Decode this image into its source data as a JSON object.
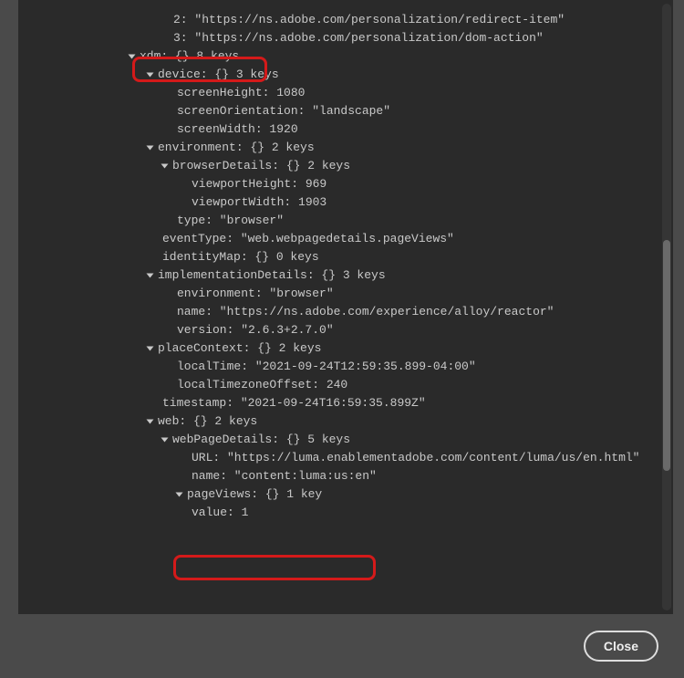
{
  "rows": {
    "index2": "2: \"https://ns.adobe.com/personalization/redirect-item\"",
    "index3": "3: \"https://ns.adobe.com/personalization/dom-action\"",
    "xdm": "xdm:  {}  8 keys",
    "device": "device:  {}  3 keys",
    "screenHeight": "screenHeight: 1080",
    "screenOrientation": "screenOrientation: \"landscape\"",
    "screenWidth": "screenWidth: 1920",
    "environment": "environment:  {}  2 keys",
    "browserDetails": "browserDetails:  {}  2 keys",
    "viewportHeight": "viewportHeight: 969",
    "viewportWidth": "viewportWidth: 1903",
    "type": "type: \"browser\"",
    "eventType": "eventType: \"web.webpagedetails.pageViews\"",
    "identityMap": "identityMap:  {}  0 keys",
    "implementationDetails": "implementationDetails:  {}  3 keys",
    "implEnvironment": "environment: \"browser\"",
    "implName": "name: \"https://ns.adobe.com/experience/alloy/reactor\"",
    "implVersion": "version: \"2.6.3+2.7.0\"",
    "placeContext": "placeContext:  {}  2 keys",
    "localTime": "localTime: \"2021-09-24T12:59:35.899-04:00\"",
    "localTimezoneOffset": "localTimezoneOffset: 240",
    "timestamp": "timestamp: \"2021-09-24T16:59:35.899Z\"",
    "web": "web:  {}  2 keys",
    "webPageDetails": "webPageDetails:  {}  5 keys",
    "url": "URL: \"https://luma.enablementadobe.com/content/luma/us/en.html\"",
    "name": "name: \"content:luma:us:en\"",
    "pageViews": "pageViews:  {}  1 key",
    "value": "value: 1"
  },
  "footer": {
    "close_label": "Close"
  }
}
